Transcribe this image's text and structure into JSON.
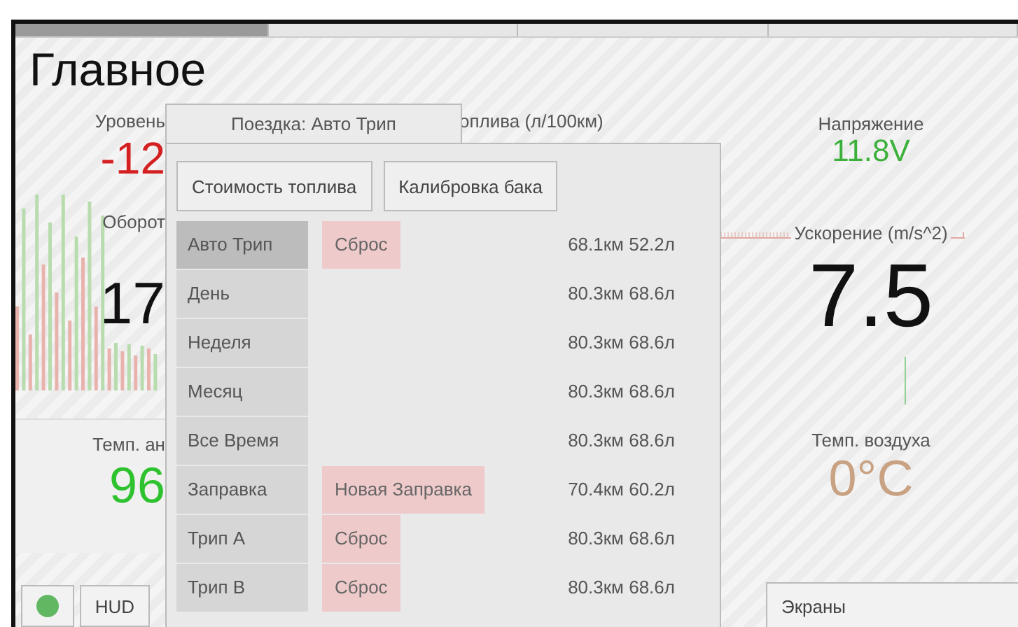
{
  "pages": [
    {
      "selected": true
    },
    {
      "selected": false
    },
    {
      "selected": false
    },
    {
      "selected": false
    }
  ],
  "title": "Главное",
  "left_gauges": [
    {
      "kind": "level",
      "label": "Уровень",
      "value": "-12"
    },
    {
      "kind": "rpm",
      "label": "Оборот",
      "value": "17"
    },
    {
      "kind": "temp",
      "label": "Темп. ан",
      "value": "96"
    }
  ],
  "fuel_label": "оплива (л/100км)",
  "right_gauges": [
    {
      "kind": "voltage",
      "label": "Напряжение",
      "value": "11.8V"
    },
    {
      "kind": "accel",
      "label": "Ускорение (m/s^2)",
      "value": "7.5"
    },
    {
      "kind": "air",
      "label": "Темп. воздуха",
      "value": "0°C"
    }
  ],
  "status": {
    "on": true
  },
  "hud_button": "HUD",
  "screens_panel": "Экраны",
  "popup": {
    "tab": "Поездка: Авто Трип",
    "buttons": [
      "Стоимость топлива",
      "Калибровка бака"
    ],
    "rows": [
      {
        "label": "Авто Трип",
        "selected": true,
        "action": "Сброс",
        "reading": "68.1км 52.2л"
      },
      {
        "label": "День",
        "selected": false,
        "reading": "80.3км 68.6л"
      },
      {
        "label": "Неделя",
        "selected": false,
        "reading": "80.3км 68.6л"
      },
      {
        "label": "Месяц",
        "selected": false,
        "reading": "80.3км 68.6л"
      },
      {
        "label": "Все Время",
        "selected": false,
        "reading": "80.3км 68.6л"
      },
      {
        "label": "Заправка",
        "selected": false,
        "action": "Новая Заправка",
        "reading": "70.4км 60.2л"
      },
      {
        "label": "Трип A",
        "selected": false,
        "action": "Сброс",
        "reading": "80.3км 68.6л"
      },
      {
        "label": "Трип B",
        "selected": false,
        "action": "Сброс",
        "reading": "80.3км 68.6л"
      }
    ]
  }
}
